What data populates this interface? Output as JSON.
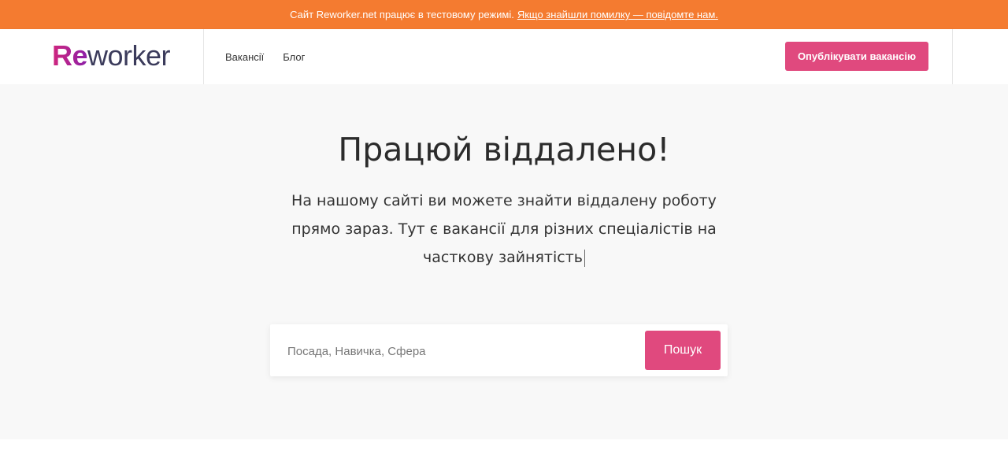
{
  "announcement": {
    "text": "Сайт Reworker.net працює в тестовому режимі.",
    "link_text": "Якщо знайшли помилку — повідомте нам.",
    "bg_color": "#f47b30"
  },
  "header": {
    "logo_accent": "Re",
    "logo_rest": "worker",
    "nav": [
      {
        "label": "Вакансії"
      },
      {
        "label": "Блог"
      }
    ],
    "publish_label": "Опублікувати вакансію",
    "accent_color": "#e0497e"
  },
  "hero": {
    "title": "Працюй віддалено!",
    "subtitle": "На нашому сайті ви можете знайти віддалену роботу прямо зараз. Тут є вакансії для різних спеціалістів на часткову зайнятість"
  },
  "search": {
    "placeholder": "Посада, Навичка, Сфера",
    "value": "",
    "button_label": "Пошук"
  }
}
